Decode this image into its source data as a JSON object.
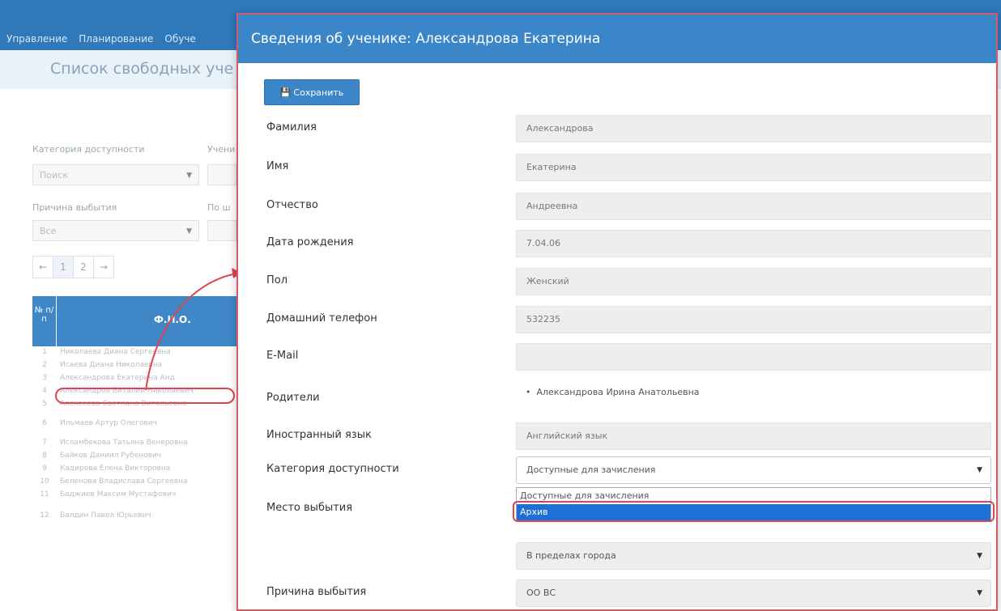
{
  "background": {
    "nav_items": [
      "Управление",
      "Планирование",
      "Обуче"
    ],
    "page_title": "Список свободных уче",
    "filters": {
      "category_label": "Категория доступности",
      "category_value": "Поиск",
      "students_label": "Учени",
      "reason_label": "Причина выбытия",
      "reason_value": "Все",
      "by_label": "По ш"
    },
    "pager": [
      "←",
      "1",
      "2",
      "→"
    ],
    "table_header": {
      "num": "№ п/п",
      "name": "Ф.И.О."
    },
    "rows": [
      {
        "n": "1",
        "t": "Николаева Диана Сергеевна"
      },
      {
        "n": "2",
        "t": "Исаева Диана Николаевна"
      },
      {
        "n": "3",
        "t": "Александрова Екатерина Анд"
      },
      {
        "n": "4",
        "t": "Александров Виталий Николаевич"
      },
      {
        "n": "5",
        "t": "Алексеева Светлана Витальевна"
      },
      {
        "n": "6",
        "t": "Ильмаев Артур Олегович"
      },
      {
        "n": "7",
        "t": "Исламбекова Татьяна Венеровна"
      },
      {
        "n": "8",
        "t": "Байков Даниил Рубенович"
      },
      {
        "n": "9",
        "t": "Кадирова Елена Викторовна"
      },
      {
        "n": "10",
        "t": "Беленова Владислава Сергеевна"
      },
      {
        "n": "11",
        "t": "Баджиев Максим Мустафович"
      },
      {
        "n": "12",
        "t": "Балдин Павел Юрьевич"
      }
    ]
  },
  "modal": {
    "title": "Сведения об ученике: Александрова Екатерина",
    "save_label": "Сохранить",
    "fields": {
      "surname": {
        "label": "Фамилия",
        "value": "Александрова"
      },
      "name": {
        "label": "Имя",
        "value": "Екатерина"
      },
      "patronymic": {
        "label": "Отчество",
        "value": "Андреевна"
      },
      "birthdate": {
        "label": "Дата рождения",
        "value": "7.04.06"
      },
      "gender": {
        "label": "Пол",
        "value": "Женский"
      },
      "home_phone": {
        "label": "Домашний телефон",
        "value": "532235"
      },
      "email": {
        "label": "E-Mail",
        "value": ""
      },
      "parents": {
        "label": "Родители",
        "items": [
          "Александрова Ирина Анатольевна"
        ]
      },
      "language": {
        "label": "Иностранный язык",
        "value": "Английский язык"
      },
      "category": {
        "label": "Категория доступности",
        "value": "Доступные для зачисления",
        "options": [
          "Доступные для зачисления",
          "Архив"
        ],
        "highlighted_option": "Архив"
      },
      "departure_place": {
        "label": "Место выбытия",
        "value": "В пределах города"
      },
      "departure_reason": {
        "label": "Причина выбытия",
        "value": "ОО ВС"
      }
    }
  },
  "colors": {
    "header_blue": "#3a86c8",
    "highlight_red": "#e0444d",
    "selected_option": "#1e70d6"
  }
}
